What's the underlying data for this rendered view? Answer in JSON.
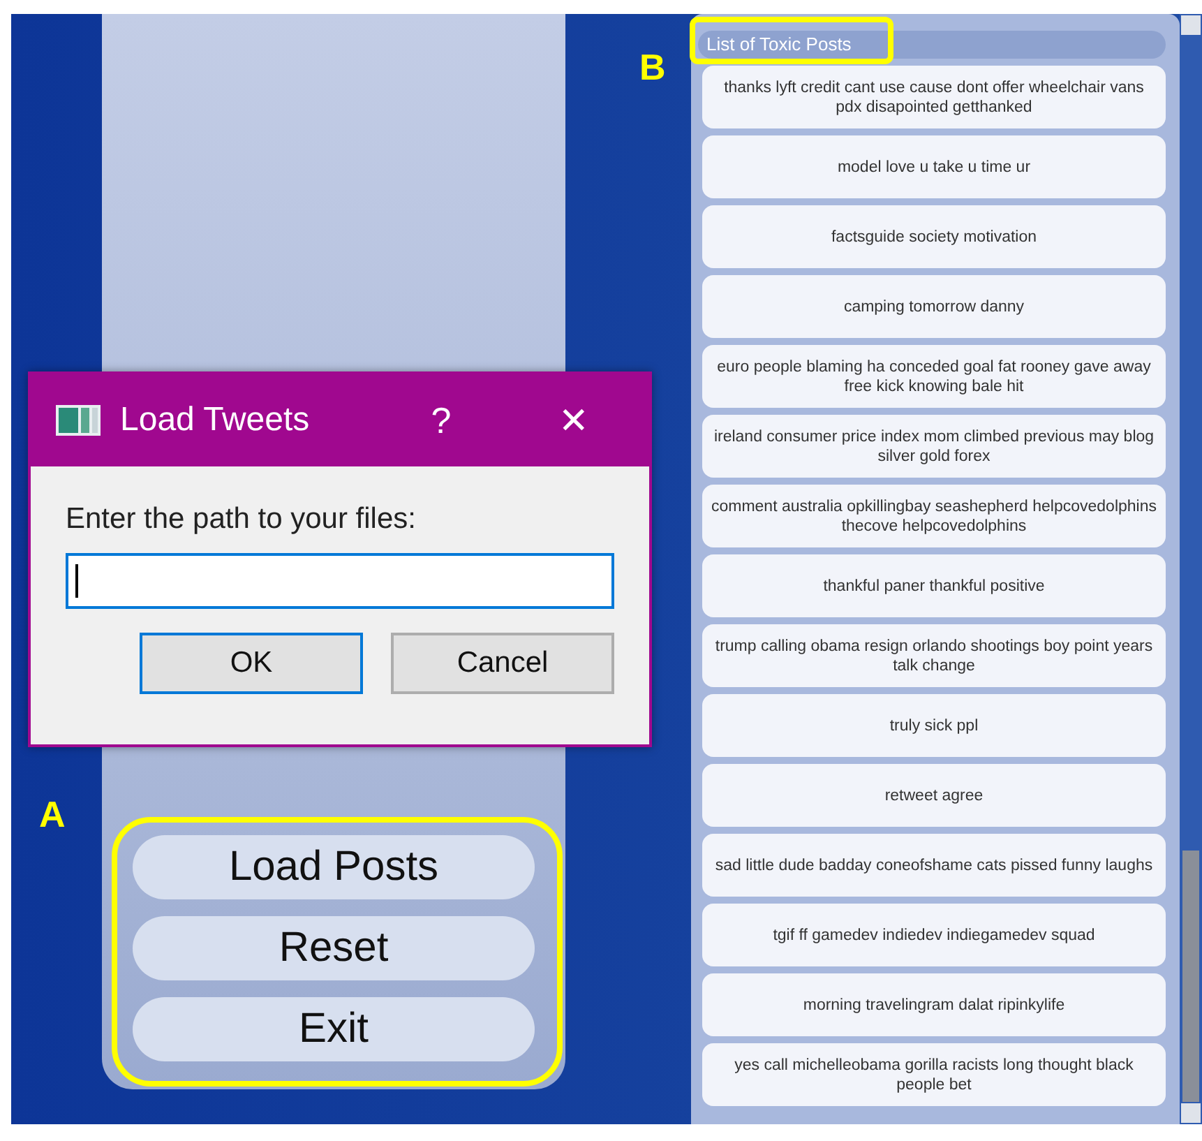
{
  "main_buttons": [
    {
      "label": "Load Posts"
    },
    {
      "label": "Reset"
    },
    {
      "label": "Exit"
    }
  ],
  "toxic_list": {
    "title": "List of Toxic Posts",
    "posts": [
      "thanks lyft credit cant use cause dont offer wheelchair vans pdx disapointed getthanked",
      "model love u take u time ur",
      "factsguide society motivation",
      "camping tomorrow danny",
      "euro people blaming ha conceded goal fat rooney gave away free kick knowing bale hit",
      "ireland consumer price index mom climbed previous may blog silver gold forex",
      "comment australia opkillingbay seashepherd helpcovedolphins thecove helpcovedolphins",
      "thankful paner thankful positive",
      "trump calling obama resign orlando shootings boy point years talk change",
      "truly sick ppl",
      "retweet agree",
      "sad little dude badday coneofshame cats pissed funny laughs",
      "tgif ff gamedev indiedev indiegamedev squad",
      "morning travelingram dalat ripinkylife",
      "yes call michelleobama gorilla racists long thought black people bet"
    ]
  },
  "dialog": {
    "title": "Load Tweets",
    "help": "?",
    "close": "✕",
    "prompt": "Enter the path to your files:",
    "input": {
      "focused": true
    },
    "buttons": [
      {
        "label": "OK",
        "default": true
      },
      {
        "label": "Cancel",
        "default": false
      }
    ]
  },
  "annotations": [
    {
      "label": "A",
      "kind": "buttons"
    },
    {
      "label": "B",
      "kind": "list_title"
    }
  ]
}
